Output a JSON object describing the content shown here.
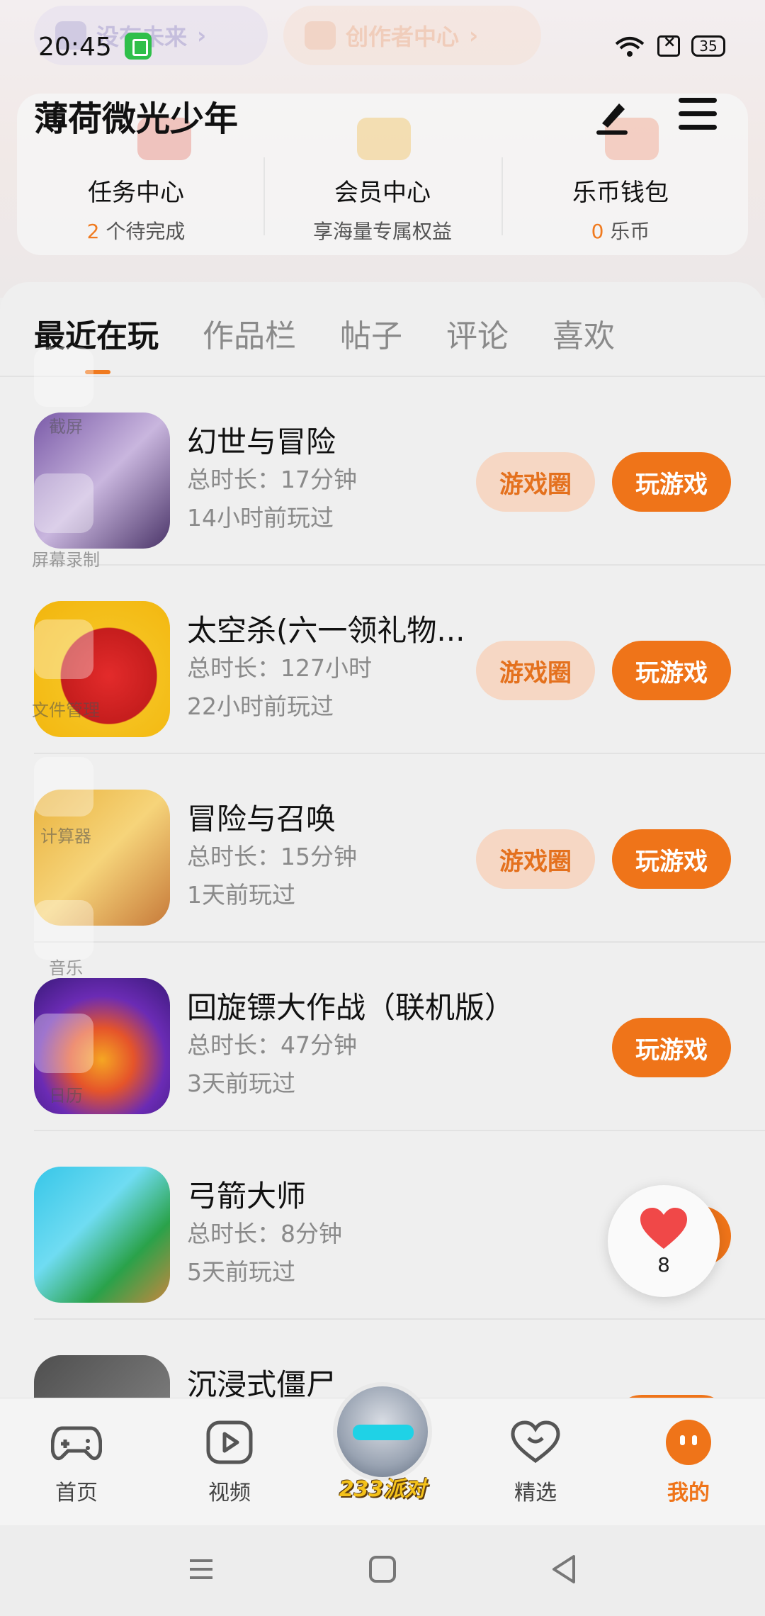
{
  "status_bar": {
    "time": "20:45",
    "battery": "35"
  },
  "banner": {
    "pill1": "没有未来",
    "pill2": "创作者中心"
  },
  "header": {
    "title": "薄荷微光少年"
  },
  "stats": [
    {
      "title": "任务中心",
      "count": "2",
      "suffix": " 个待完成"
    },
    {
      "title": "会员中心",
      "sub": "享海量专属权益"
    },
    {
      "title": "乐币钱包",
      "count": "0",
      "suffix": " 乐币"
    }
  ],
  "tabs": [
    "最近在玩",
    "作品栏",
    "帖子",
    "评论",
    "喜欢"
  ],
  "games": [
    {
      "name": "幻世与冒险",
      "duration": "总时长：17分钟",
      "last": "14小时前玩过",
      "circle": "游戏圈",
      "play": "玩游戏"
    },
    {
      "name": "太空杀(六一领礼物...",
      "duration": "总时长：127小时",
      "last": "22小时前玩过",
      "circle": "游戏圈",
      "play": "玩游戏"
    },
    {
      "name": "冒险与召唤",
      "duration": "总时长：15分钟",
      "last": "1天前玩过",
      "circle": "游戏圈",
      "play": "玩游戏"
    },
    {
      "name": "回旋镖大作战（联机版）",
      "duration": "总时长：47分钟",
      "last": "3天前玩过",
      "play": "玩游戏"
    },
    {
      "name": "弓箭大师",
      "duration": "总时长：8分钟",
      "last": "5天前玩过"
    },
    {
      "name": "沉浸式僵尸"
    }
  ],
  "like": {
    "count": "8"
  },
  "sidebar_overlay": [
    "截屏",
    "屏幕录制",
    "文件管理",
    "计算器",
    "音乐",
    "日历"
  ],
  "bottom_nav": [
    "首页",
    "视频",
    "精选",
    "我的"
  ],
  "brand": "233派对",
  "colors": {
    "accent": "#ef7419",
    "circle_bg": "#f6d7c4"
  }
}
